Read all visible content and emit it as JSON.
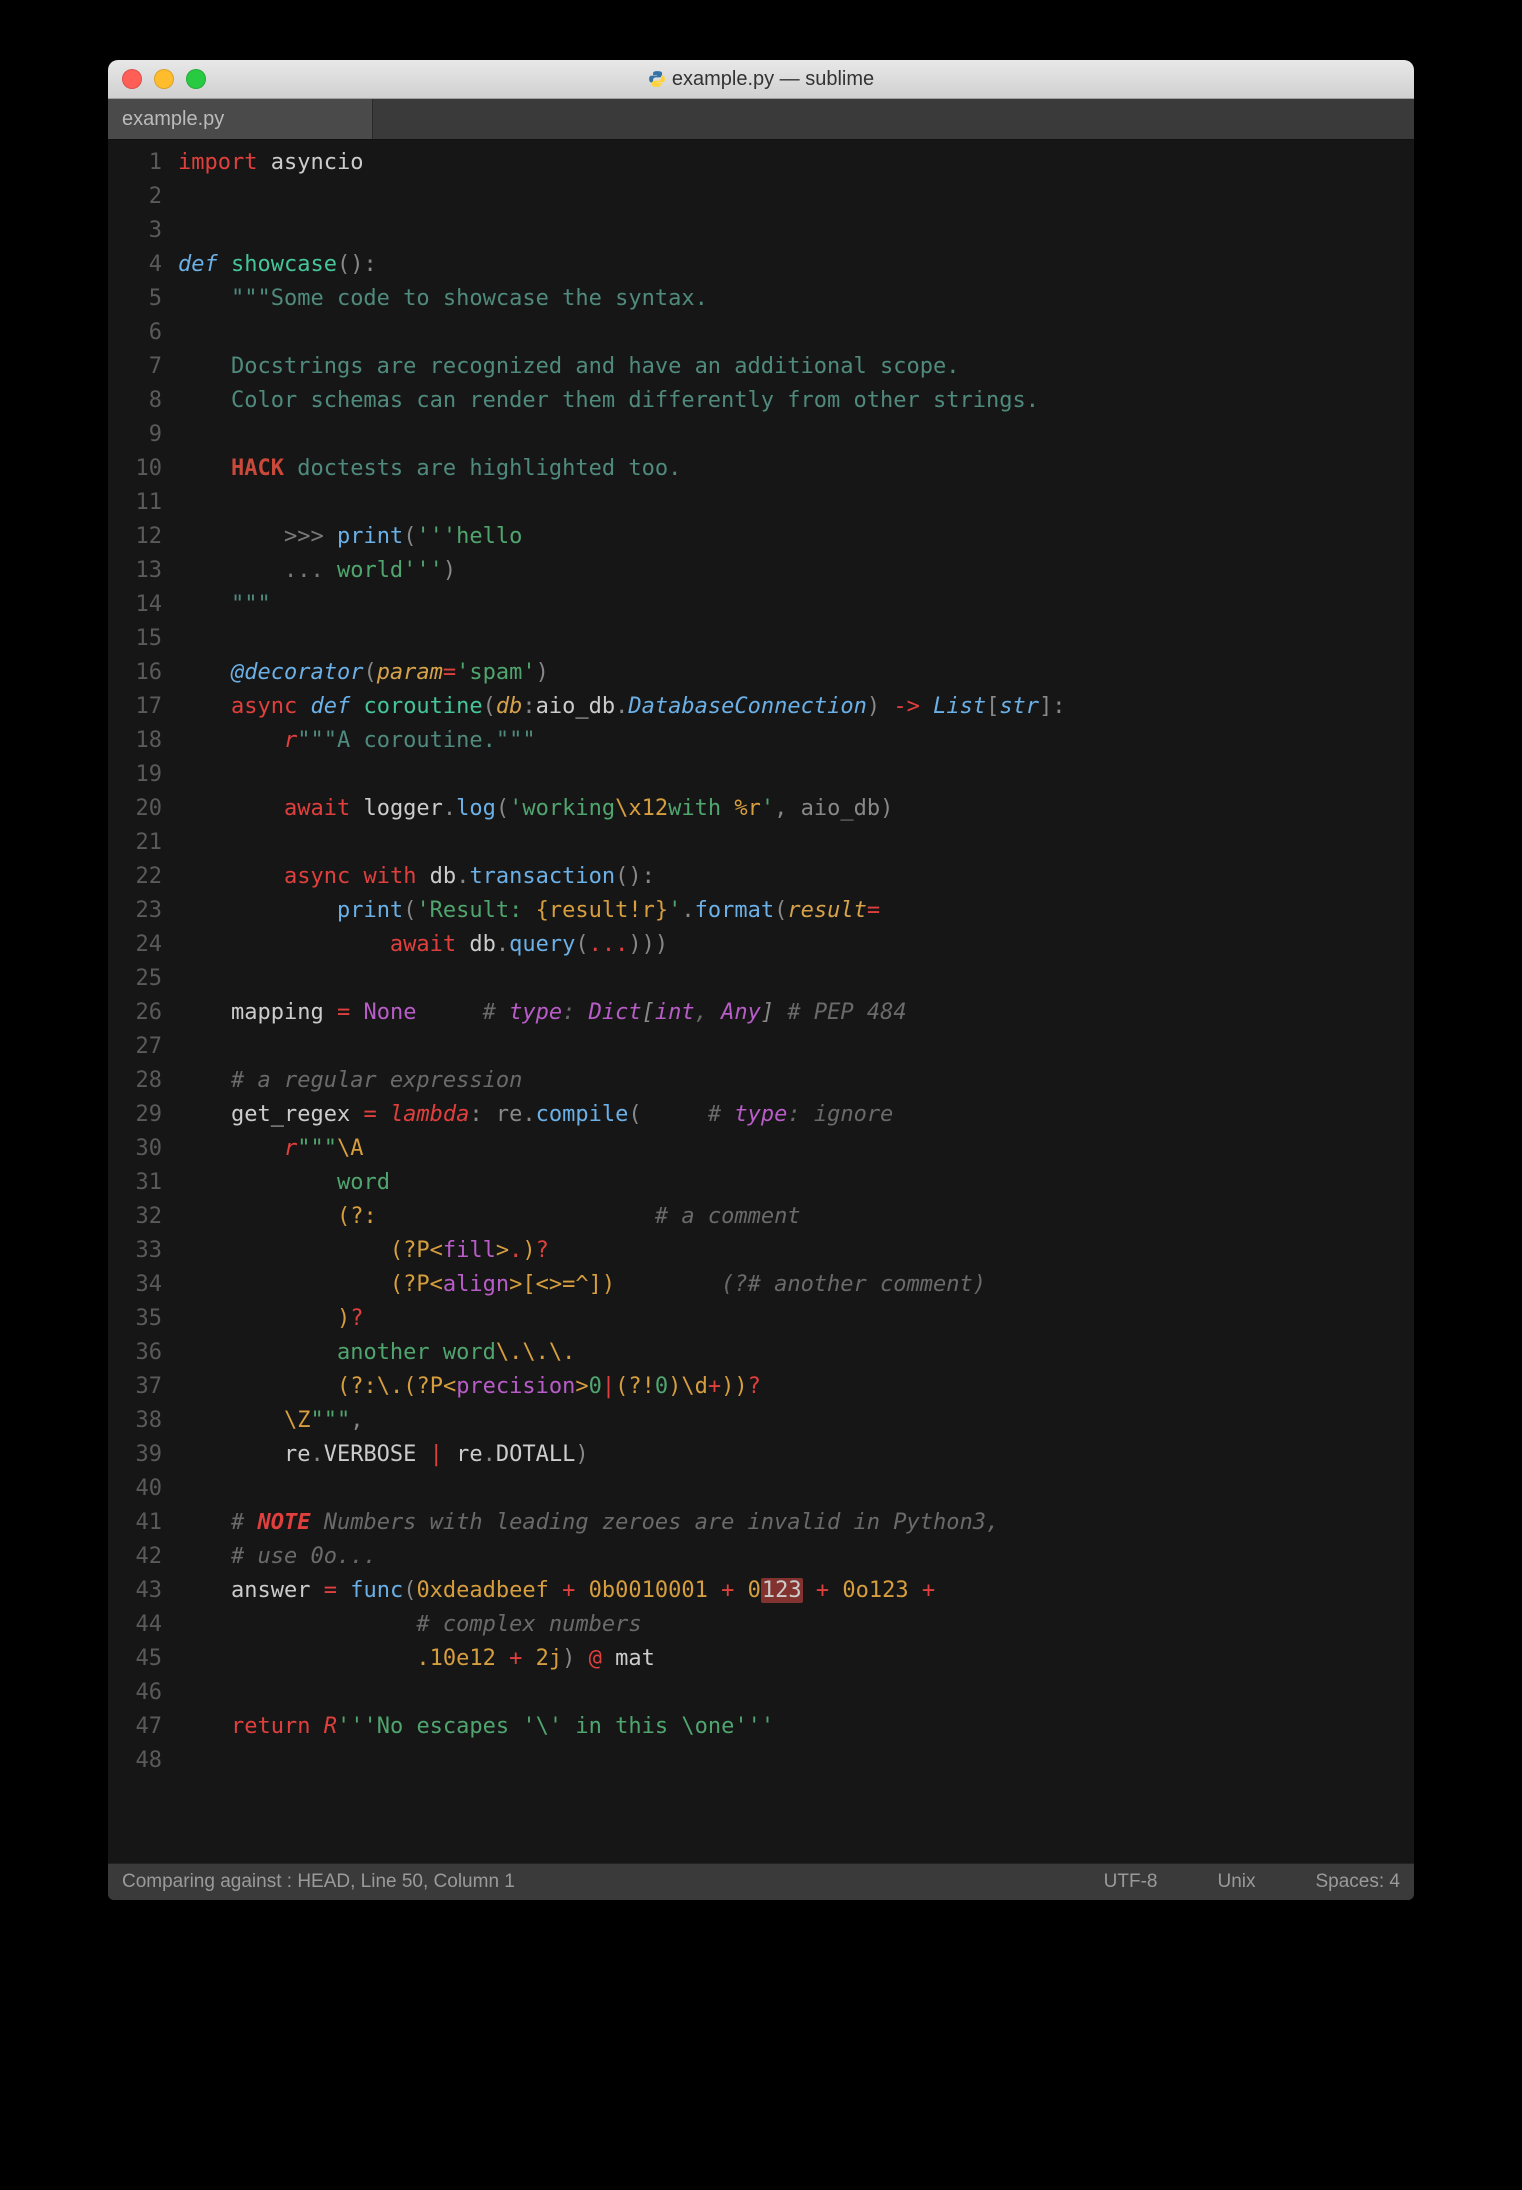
{
  "window": {
    "title": "example.py — sublime",
    "tab_label": "example.py"
  },
  "statusbar": {
    "left": "Comparing against : HEAD, Line 50, Column 1",
    "encoding": "UTF-8",
    "line_endings": "Unix",
    "indent": "Spaces: 4"
  },
  "gutter": {
    "start": 1,
    "end": 48
  },
  "code_lines": [
    [
      [
        "kw",
        "import"
      ],
      [
        "var",
        " asyncio"
      ]
    ],
    [],
    [],
    [
      [
        "def",
        "def "
      ],
      [
        "fn",
        "showcase"
      ],
      [
        "punc",
        "():"
      ]
    ],
    [
      [
        "var",
        "    "
      ],
      [
        "doc",
        "\"\"\"Some code to showcase the syntax."
      ]
    ],
    [],
    [
      [
        "var",
        "    "
      ],
      [
        "doc",
        "Docstrings are recognized and have an additional scope."
      ]
    ],
    [
      [
        "var",
        "    "
      ],
      [
        "doc",
        "Color schemas can render them differently from other strings."
      ]
    ],
    [],
    [
      [
        "var",
        "    "
      ],
      [
        "doc-tag",
        "HACK"
      ],
      [
        "doc",
        " doctests are highlighted too."
      ]
    ],
    [],
    [
      [
        "var",
        "        "
      ],
      [
        "doc-prompt",
        ">>> "
      ],
      [
        "call",
        "print"
      ],
      [
        "punc",
        "("
      ],
      [
        "str",
        "'''hello"
      ]
    ],
    [
      [
        "var",
        "        "
      ],
      [
        "doc-prompt",
        "... "
      ],
      [
        "str",
        "world'''"
      ],
      [
        "punc",
        ")"
      ]
    ],
    [
      [
        "var",
        "    "
      ],
      [
        "doc",
        "\"\"\""
      ]
    ],
    [],
    [
      [
        "var",
        "    "
      ],
      [
        "deco",
        "@decorator"
      ],
      [
        "punc",
        "("
      ],
      [
        "param",
        "param"
      ],
      [
        "op",
        "="
      ],
      [
        "str",
        "'spam'"
      ],
      [
        "punc",
        ")"
      ]
    ],
    [
      [
        "var",
        "    "
      ],
      [
        "kw",
        "async "
      ],
      [
        "def",
        "def "
      ],
      [
        "fn",
        "coroutine"
      ],
      [
        "punc",
        "("
      ],
      [
        "param",
        "db"
      ],
      [
        "punc",
        ":"
      ],
      [
        "var",
        "aio_db"
      ],
      [
        "punc",
        "."
      ],
      [
        "type",
        "DatabaseConnection"
      ],
      [
        "punc",
        ") "
      ],
      [
        "op",
        "->"
      ],
      [
        "punc",
        " "
      ],
      [
        "type",
        "List"
      ],
      [
        "punc",
        "["
      ],
      [
        "type",
        "str"
      ],
      [
        "punc",
        "]:"
      ]
    ],
    [
      [
        "var",
        "        "
      ],
      [
        "str-prefix",
        "r"
      ],
      [
        "doc",
        "\"\"\"A coroutine.\"\"\""
      ]
    ],
    [],
    [
      [
        "var",
        "        "
      ],
      [
        "kw",
        "await"
      ],
      [
        "var",
        " logger"
      ],
      [
        "punc",
        "."
      ],
      [
        "call",
        "log"
      ],
      [
        "punc",
        "("
      ],
      [
        "str",
        "'working"
      ],
      [
        "esc",
        "\\x12"
      ],
      [
        "str",
        "with "
      ],
      [
        "place",
        "%r"
      ],
      [
        "str",
        "'"
      ],
      [
        "punc",
        ", aio_db)"
      ]
    ],
    [],
    [
      [
        "var",
        "        "
      ],
      [
        "kw",
        "async "
      ],
      [
        "kw",
        "with"
      ],
      [
        "var",
        " db"
      ],
      [
        "punc",
        "."
      ],
      [
        "call",
        "transaction"
      ],
      [
        "punc",
        "():"
      ]
    ],
    [
      [
        "var",
        "            "
      ],
      [
        "call",
        "print"
      ],
      [
        "punc",
        "("
      ],
      [
        "str",
        "'Result: "
      ],
      [
        "place",
        "{result!r}"
      ],
      [
        "str",
        "'"
      ],
      [
        "punc",
        "."
      ],
      [
        "call",
        "format"
      ],
      [
        "punc",
        "("
      ],
      [
        "param",
        "result"
      ],
      [
        "op",
        "="
      ]
    ],
    [
      [
        "var",
        "                "
      ],
      [
        "kw",
        "await"
      ],
      [
        "var",
        " db"
      ],
      [
        "punc",
        "."
      ],
      [
        "call",
        "query"
      ],
      [
        "punc",
        "("
      ],
      [
        "op",
        "..."
      ],
      [
        "punc",
        ")))"
      ]
    ],
    [],
    [
      [
        "var",
        "    mapping "
      ],
      [
        "op",
        "="
      ],
      [
        "var",
        " "
      ],
      [
        "const",
        "None"
      ],
      [
        "var",
        "     "
      ],
      [
        "cmt",
        "# "
      ],
      [
        "cmt-typekw",
        "type"
      ],
      [
        "cmt-type",
        ": "
      ],
      [
        "ann",
        "Dict"
      ],
      [
        "cmt-typebr",
        "["
      ],
      [
        "ann",
        "int"
      ],
      [
        "cmt-type",
        ", "
      ],
      [
        "ann",
        "Any"
      ],
      [
        "cmt-typebr",
        "]"
      ],
      [
        "cmt",
        " # PEP 484"
      ]
    ],
    [],
    [
      [
        "var",
        "    "
      ],
      [
        "cmt",
        "# a regular expression"
      ]
    ],
    [
      [
        "var",
        "    get_regex "
      ],
      [
        "op",
        "="
      ],
      [
        "var",
        " "
      ],
      [
        "kw2",
        "lambda"
      ],
      [
        "punc",
        ": re."
      ],
      [
        "call",
        "compile"
      ],
      [
        "punc",
        "(     "
      ],
      [
        "cmt",
        "# "
      ],
      [
        "cmt-typekw",
        "type"
      ],
      [
        "cmt-type",
        ": ignore"
      ]
    ],
    [
      [
        "var",
        "        "
      ],
      [
        "str-prefix",
        "r"
      ],
      [
        "str",
        "\"\"\""
      ],
      [
        "re-esc",
        "\\A"
      ]
    ],
    [
      [
        "var",
        "            "
      ],
      [
        "re-lit",
        "word"
      ]
    ],
    [
      [
        "var",
        "            "
      ],
      [
        "re-grp",
        "(?:"
      ],
      [
        "var",
        "                     "
      ],
      [
        "cmt",
        "# a comment"
      ]
    ],
    [
      [
        "var",
        "                "
      ],
      [
        "re-grp",
        "(?P<"
      ],
      [
        "re-name",
        "fill"
      ],
      [
        "re-grp",
        ">"
      ],
      [
        "re-op",
        "."
      ],
      [
        "re-grp",
        ")"
      ],
      [
        "re-q",
        "?"
      ]
    ],
    [
      [
        "var",
        "                "
      ],
      [
        "re-grp",
        "(?P<"
      ],
      [
        "re-name",
        "align"
      ],
      [
        "re-grp",
        ">"
      ],
      [
        "re-cls",
        "[<>=^]"
      ],
      [
        "re-grp",
        ")"
      ],
      [
        "var",
        "        "
      ],
      [
        "cmt",
        "(?# another comment)"
      ]
    ],
    [
      [
        "var",
        "            "
      ],
      [
        "re-grp",
        ")"
      ],
      [
        "re-q",
        "?"
      ]
    ],
    [
      [
        "var",
        "            "
      ],
      [
        "re-lit",
        "another word"
      ],
      [
        "re-esc",
        "\\."
      ],
      [
        "re-esc",
        "\\."
      ],
      [
        "re-esc",
        "\\."
      ]
    ],
    [
      [
        "var",
        "            "
      ],
      [
        "re-grp",
        "(?:"
      ],
      [
        "re-esc",
        "\\."
      ],
      [
        "re-grp",
        "(?P<"
      ],
      [
        "re-name",
        "precision"
      ],
      [
        "re-grp",
        ">"
      ],
      [
        "re-lit",
        "0"
      ],
      [
        "re-op",
        "|"
      ],
      [
        "re-grp",
        "(?!"
      ],
      [
        "re-lit",
        "0"
      ],
      [
        "re-grp",
        ")"
      ],
      [
        "re-esc",
        "\\d"
      ],
      [
        "re-q",
        "+"
      ],
      [
        "re-grp",
        "))"
      ],
      [
        "re-q",
        "?"
      ]
    ],
    [
      [
        "var",
        "        "
      ],
      [
        "re-esc",
        "\\Z"
      ],
      [
        "str",
        "\"\"\""
      ],
      [
        "punc",
        ","
      ]
    ],
    [
      [
        "var",
        "        re"
      ],
      [
        "punc",
        "."
      ],
      [
        "var",
        "VERBOSE "
      ],
      [
        "op",
        "|"
      ],
      [
        "var",
        " re"
      ],
      [
        "punc",
        "."
      ],
      [
        "var",
        "DOTALL"
      ],
      [
        "punc",
        ")"
      ]
    ],
    [],
    [
      [
        "var",
        "    "
      ],
      [
        "cmt",
        "# "
      ],
      [
        "note",
        "NOTE"
      ],
      [
        "cmt",
        " Numbers with leading zeroes are invalid in Python3,"
      ]
    ],
    [
      [
        "var",
        "    "
      ],
      [
        "cmt",
        "# use 0o..."
      ]
    ],
    [
      [
        "var",
        "    answer "
      ],
      [
        "op",
        "="
      ],
      [
        "var",
        " "
      ],
      [
        "call",
        "func"
      ],
      [
        "punc",
        "("
      ],
      [
        "num",
        "0xdeadbeef"
      ],
      [
        "var",
        " "
      ],
      [
        "op",
        "+"
      ],
      [
        "var",
        " "
      ],
      [
        "num",
        "0b0010001"
      ],
      [
        "var",
        " "
      ],
      [
        "op",
        "+"
      ],
      [
        "var",
        " "
      ],
      [
        "num",
        "0"
      ],
      [
        "err",
        "123"
      ],
      [
        "var",
        " "
      ],
      [
        "op",
        "+"
      ],
      [
        "var",
        " "
      ],
      [
        "num",
        "0o123"
      ],
      [
        "var",
        " "
      ],
      [
        "op",
        "+"
      ]
    ],
    [
      [
        "var",
        "                  "
      ],
      [
        "cmt",
        "# complex numbers"
      ]
    ],
    [
      [
        "var",
        "                  "
      ],
      [
        "num",
        ".10e12"
      ],
      [
        "var",
        " "
      ],
      [
        "op",
        "+"
      ],
      [
        "var",
        " "
      ],
      [
        "num",
        "2j"
      ],
      [
        "punc",
        ") "
      ],
      [
        "op",
        "@"
      ],
      [
        "var",
        " mat"
      ]
    ],
    [],
    [
      [
        "var",
        "    "
      ],
      [
        "kw",
        "return"
      ],
      [
        "var",
        " "
      ],
      [
        "str-prefix",
        "R"
      ],
      [
        "str",
        "'''No escapes '\\' in this \\one'''"
      ]
    ],
    []
  ],
  "token_class_map": {
    "kw": "t-kw",
    "kw2": "t-kw2",
    "def": "t-def",
    "fn": "t-fn",
    "call": "t-call",
    "punc": "t-punc",
    "op": "t-op",
    "str": "t-str",
    "doc": "t-doc",
    "doc-tag": "t-doc-tag",
    "doc-prompt": "t-doc-prompt",
    "num": "t-num",
    "const": "t-const",
    "var": "t-var",
    "cmt": "t-cmt",
    "ann": "t-ann",
    "type": "t-type",
    "esc": "t-esc",
    "place": "t-place",
    "re-grp": "t-re-grp",
    "re-name": "t-re-name",
    "re-cls": "t-re-cls",
    "re-esc": "t-re-esc",
    "re-op": "t-re-op",
    "re-q": "t-re-q",
    "re-lit": "t-re-lit",
    "cmt-type": "t-cmt-type",
    "cmt-typekw": "t-cmt-typekw",
    "cmt-typebr": "t-cmt-typebr",
    "note": "t-note",
    "err": "t-err",
    "param": "t-param",
    "self": "t-self",
    "deco": "t-deco",
    "str-prefix": "t-str-prefix"
  }
}
